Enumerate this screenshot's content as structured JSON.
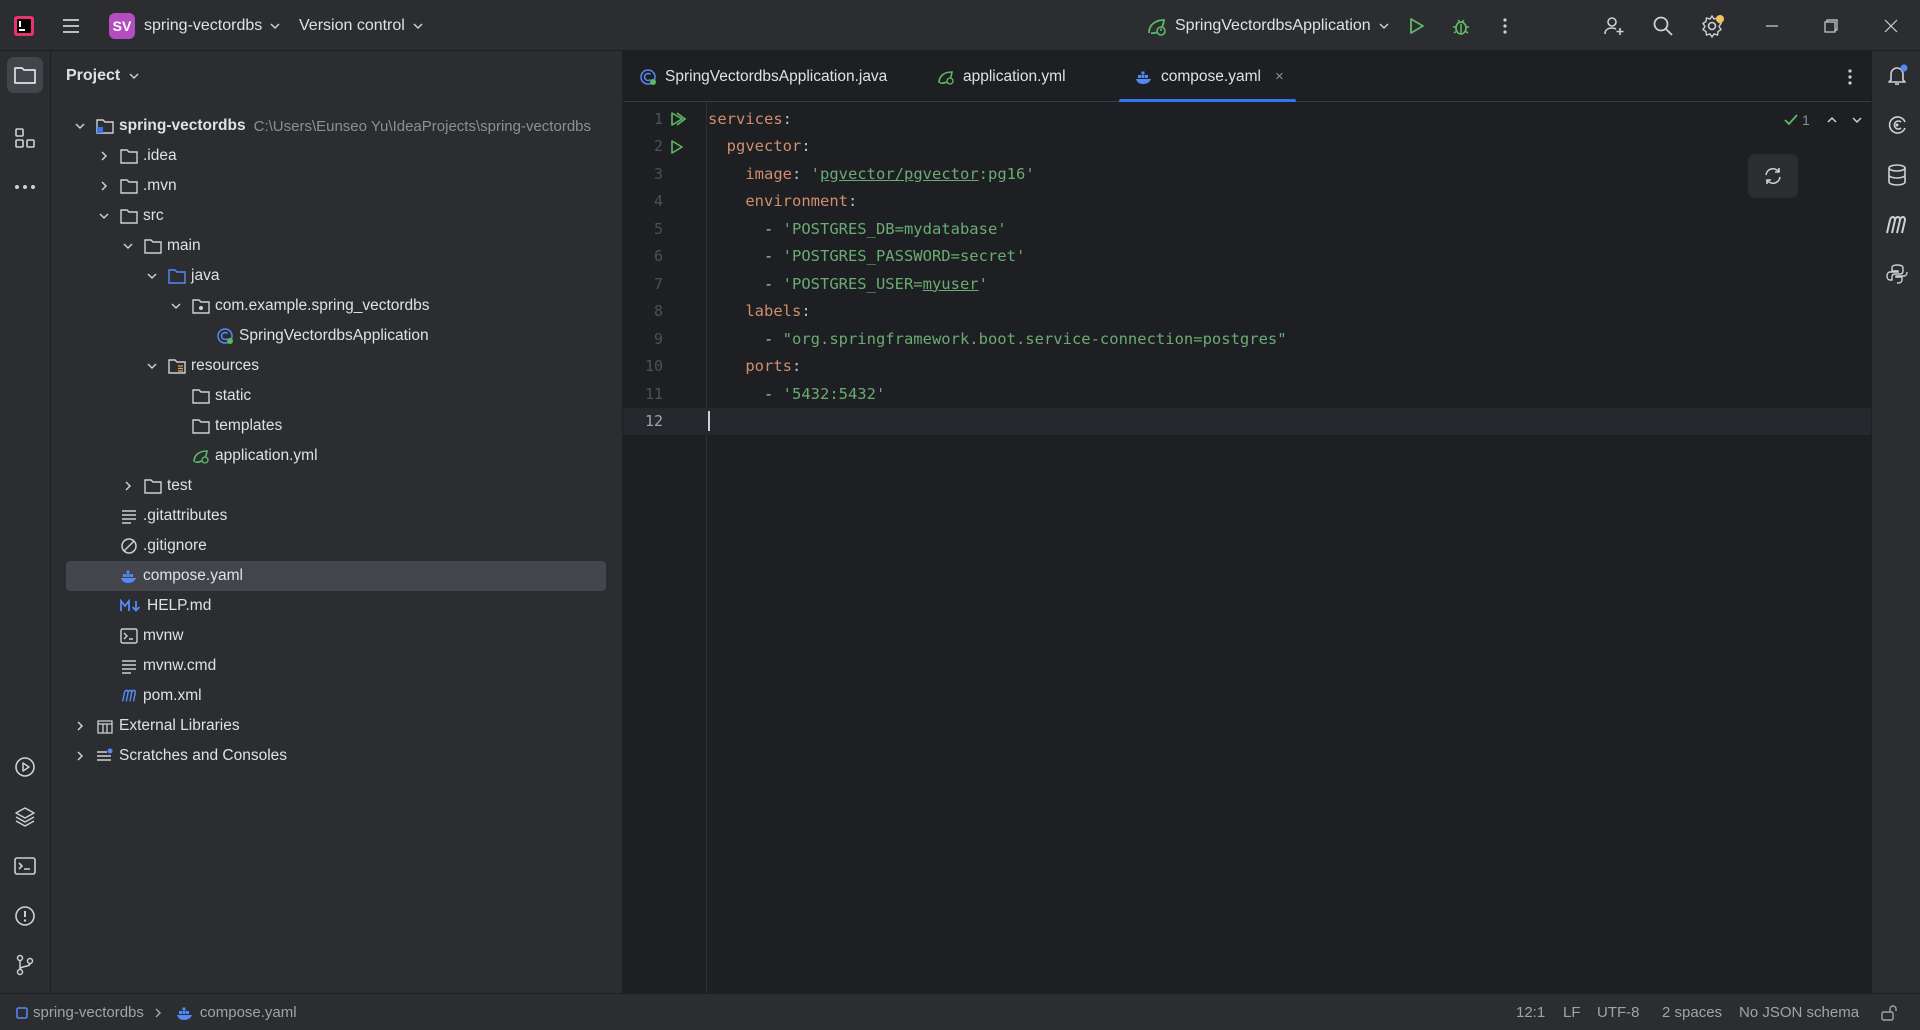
{
  "titlebar": {
    "project_badge": "SV",
    "project_name": "spring-vectordbs",
    "vcs_label": "Version control",
    "run_config": "SpringVectordbsApplication",
    "icons": [
      "intellij-logo-icon",
      "main-menu-icon",
      "run-icon",
      "debug-icon",
      "more-icon",
      "add-user-icon",
      "search-icon",
      "settings-icon",
      "minimize-icon",
      "restore-icon",
      "close-icon"
    ]
  },
  "left_strip": {
    "icons": [
      "project-icon",
      "structure-icon",
      "more-tools-icon",
      "services-icon",
      "layers-icon",
      "terminal-icon",
      "problems-icon",
      "git-icon"
    ]
  },
  "project_panel": {
    "title": "Project",
    "tree": [
      {
        "label": "spring-vectordbs",
        "path": "C:\\Users\\Eunseo Yu\\IdeaProjects\\spring-vectordbs",
        "icon": "module-folder-icon",
        "expanded": true
      },
      {
        "label": ".idea",
        "icon": "folder-icon",
        "expanded": false
      },
      {
        "label": ".mvn",
        "icon": "folder-icon",
        "expanded": false
      },
      {
        "label": "src",
        "icon": "folder-icon",
        "expanded": true
      },
      {
        "label": "main",
        "icon": "folder-icon",
        "expanded": true
      },
      {
        "label": "java",
        "icon": "source-folder-icon",
        "expanded": true
      },
      {
        "label": "com.example.spring_vectordbs",
        "icon": "package-icon",
        "expanded": true
      },
      {
        "label": "SpringVectordbsApplication",
        "icon": "spring-boot-class-icon"
      },
      {
        "label": "resources",
        "icon": "resources-folder-icon",
        "expanded": true
      },
      {
        "label": "static",
        "icon": "folder-icon"
      },
      {
        "label": "templates",
        "icon": "folder-icon"
      },
      {
        "label": "application.yml",
        "icon": "spring-yaml-icon"
      },
      {
        "label": "test",
        "icon": "folder-icon",
        "expanded": false
      },
      {
        "label": ".gitattributes",
        "icon": "text-file-icon"
      },
      {
        "label": ".gitignore",
        "icon": "ignore-file-icon"
      },
      {
        "label": "compose.yaml",
        "icon": "docker-icon",
        "selected": true
      },
      {
        "label": "HELP.md",
        "icon": "markdown-icon"
      },
      {
        "label": "mvnw",
        "icon": "shell-script-icon"
      },
      {
        "label": "mvnw.cmd",
        "icon": "text-file-icon"
      },
      {
        "label": "pom.xml",
        "icon": "maven-icon"
      },
      {
        "label": "External Libraries",
        "icon": "libraries-icon",
        "expanded": false
      },
      {
        "label": "Scratches and Consoles",
        "icon": "scratches-icon",
        "expanded": false
      }
    ]
  },
  "tabs": [
    {
      "label": "SpringVectordbsApplication.java",
      "icon": "spring-boot-class-icon",
      "active": false
    },
    {
      "label": "application.yml",
      "icon": "spring-yaml-icon",
      "active": false
    },
    {
      "label": "compose.yaml",
      "icon": "docker-icon",
      "active": true,
      "close": "×"
    }
  ],
  "editor": {
    "inspection_count": "1",
    "current_line": 12,
    "lines": [
      {
        "num": "1",
        "tokens": [
          {
            "t": "services",
            "c": "k"
          },
          {
            "t": ":",
            "c": "d"
          }
        ]
      },
      {
        "num": "2",
        "tokens": [
          {
            "t": "  pgvector",
            "c": "k"
          },
          {
            "t": ":",
            "c": "d"
          }
        ]
      },
      {
        "num": "3",
        "tokens": [
          {
            "t": "    image",
            "c": "k"
          },
          {
            "t": ": ",
            "c": "d"
          },
          {
            "t": "'",
            "c": "s"
          },
          {
            "t": "pgvector/pgvector",
            "c": "s u"
          },
          {
            "t": ":pg16'",
            "c": "s"
          }
        ]
      },
      {
        "num": "4",
        "tokens": [
          {
            "t": "    environment",
            "c": "k"
          },
          {
            "t": ":",
            "c": "d"
          }
        ]
      },
      {
        "num": "5",
        "tokens": [
          {
            "t": "      - ",
            "c": "d"
          },
          {
            "t": "'POSTGRES_DB=mydatabase'",
            "c": "s"
          }
        ]
      },
      {
        "num": "6",
        "tokens": [
          {
            "t": "      - ",
            "c": "d"
          },
          {
            "t": "'POSTGRES_PASSWORD=secret'",
            "c": "s"
          }
        ]
      },
      {
        "num": "7",
        "tokens": [
          {
            "t": "      - ",
            "c": "d"
          },
          {
            "t": "'POSTGRES_USER=",
            "c": "s"
          },
          {
            "t": "myuser",
            "c": "s u"
          },
          {
            "t": "'",
            "c": "s"
          }
        ]
      },
      {
        "num": "8",
        "tokens": [
          {
            "t": "    labels",
            "c": "k"
          },
          {
            "t": ":",
            "c": "d"
          }
        ]
      },
      {
        "num": "9",
        "tokens": [
          {
            "t": "      - ",
            "c": "d"
          },
          {
            "t": "\"org.springframework.boot.service-connection=postgres\"",
            "c": "s"
          }
        ]
      },
      {
        "num": "10",
        "tokens": [
          {
            "t": "    ports",
            "c": "k"
          },
          {
            "t": ":",
            "c": "d"
          }
        ]
      },
      {
        "num": "11",
        "tokens": [
          {
            "t": "      - ",
            "c": "d"
          },
          {
            "t": "'5432:5432'",
            "c": "s"
          }
        ]
      },
      {
        "num": "12",
        "tokens": []
      }
    ]
  },
  "right_strip": {
    "icons": [
      "notifications-icon",
      "ai-assistant-icon",
      "database-icon",
      "maven-tool-icon",
      "python-packages-icon"
    ]
  },
  "statusbar": {
    "breadcrumb_project": "spring-vectordbs",
    "breadcrumb_file": "compose.yaml",
    "position": "12:1",
    "line_separator": "LF",
    "encoding": "UTF-8",
    "indent": "2 spaces",
    "schema": "No JSON schema"
  },
  "colors": {
    "accent": "#3574f0",
    "keyword": "#cf8e6d",
    "string": "#6aab73",
    "run_green": "#5fb865",
    "project_badge": "#b44dc0"
  }
}
